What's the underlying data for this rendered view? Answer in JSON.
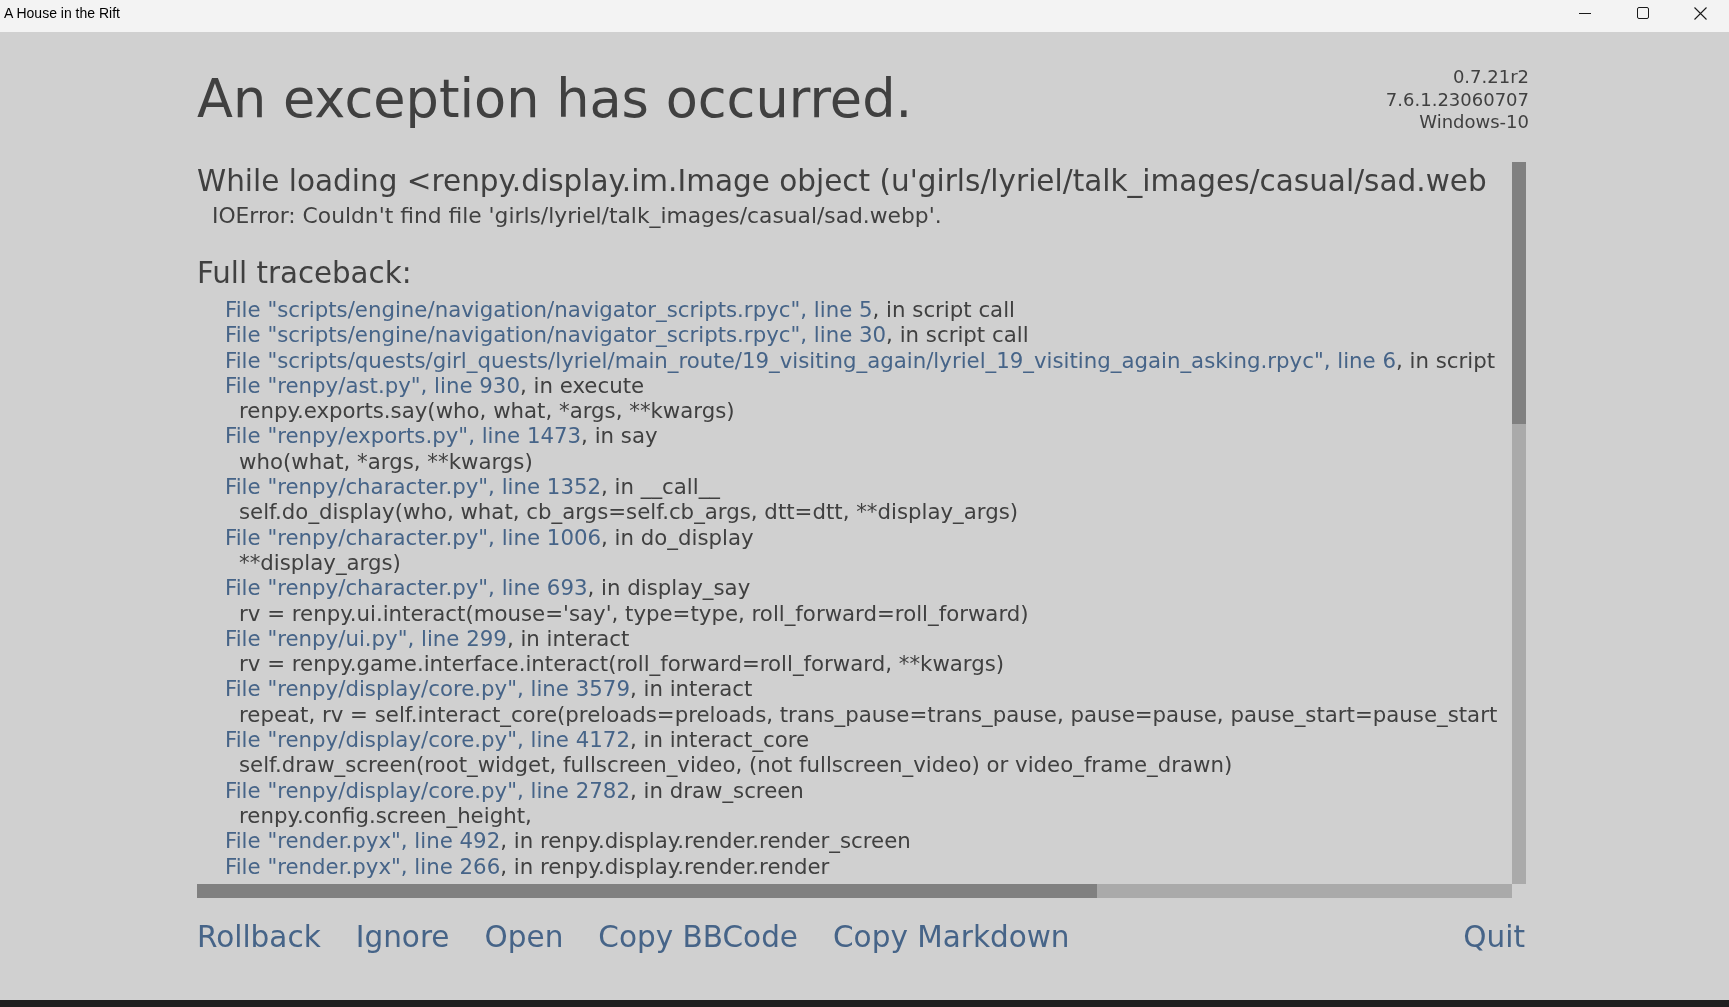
{
  "window": {
    "title": "A House in the Rift"
  },
  "error_screen": {
    "title": "An exception has occurred.",
    "version_info": [
      "0.7.21r2",
      "7.6.1.23060707",
      "Windows-10"
    ],
    "exception": "While loading <renpy.display.im.Image object (u'girls/lyriel/talk_images/casual/sad.web",
    "error_message": "IOError: Couldn't find file 'girls/lyriel/talk_images/casual/sad.webp'.",
    "traceback_heading": "Full traceback:",
    "traceback": [
      {
        "kind": "frame",
        "source": "File \"scripts/engine/navigation/navigator_scripts.rpyc\", line 5",
        "detail": ", in script call"
      },
      {
        "kind": "frame",
        "source": "File \"scripts/engine/navigation/navigator_scripts.rpyc\", line 30",
        "detail": ", in script call"
      },
      {
        "kind": "frame",
        "source": "File \"scripts/quests/girl_quests/lyriel/main_route/19_visiting_again/lyriel_19_visiting_again_asking.rpyc\", line 6",
        "detail": ", in script"
      },
      {
        "kind": "frame",
        "source": "File \"renpy/ast.py\", line 930",
        "detail": ", in execute"
      },
      {
        "kind": "code",
        "text": "renpy.exports.say(who, what, *args, **kwargs)"
      },
      {
        "kind": "frame",
        "source": "File \"renpy/exports.py\", line 1473",
        "detail": ", in say"
      },
      {
        "kind": "code",
        "text": "who(what, *args, **kwargs)"
      },
      {
        "kind": "frame",
        "source": "File \"renpy/character.py\", line 1352",
        "detail": ", in __call__"
      },
      {
        "kind": "code",
        "text": "self.do_display(who, what, cb_args=self.cb_args, dtt=dtt, **display_args)"
      },
      {
        "kind": "frame",
        "source": "File \"renpy/character.py\", line 1006",
        "detail": ", in do_display"
      },
      {
        "kind": "code",
        "text": "**display_args)"
      },
      {
        "kind": "frame",
        "source": "File \"renpy/character.py\", line 693",
        "detail": ", in display_say"
      },
      {
        "kind": "code",
        "text": "rv = renpy.ui.interact(mouse='say', type=type, roll_forward=roll_forward)"
      },
      {
        "kind": "frame",
        "source": "File \"renpy/ui.py\", line 299",
        "detail": ", in interact"
      },
      {
        "kind": "code",
        "text": "rv = renpy.game.interface.interact(roll_forward=roll_forward, **kwargs)"
      },
      {
        "kind": "frame",
        "source": "File \"renpy/display/core.py\", line 3579",
        "detail": ", in interact"
      },
      {
        "kind": "code",
        "text": "repeat, rv = self.interact_core(preloads=preloads, trans_pause=trans_pause, pause=pause, pause_start=pause_start"
      },
      {
        "kind": "frame",
        "source": "File \"renpy/display/core.py\", line 4172",
        "detail": ", in interact_core"
      },
      {
        "kind": "code",
        "text": "self.draw_screen(root_widget, fullscreen_video, (not fullscreen_video) or video_frame_drawn)"
      },
      {
        "kind": "frame",
        "source": "File \"renpy/display/core.py\", line 2782",
        "detail": ", in draw_screen"
      },
      {
        "kind": "code",
        "text": "renpy.config.screen_height,"
      },
      {
        "kind": "frame",
        "source": "File \"render.pyx\", line 492",
        "detail": ", in renpy.display.render.render_screen"
      },
      {
        "kind": "frame",
        "source": "File \"render.pyx\", line 266",
        "detail": ", in renpy.display.render.render"
      }
    ]
  },
  "actions": [
    "Rollback",
    "Ignore",
    "Open",
    "Copy BBCode",
    "Copy Markdown"
  ],
  "quit": "Quit"
}
